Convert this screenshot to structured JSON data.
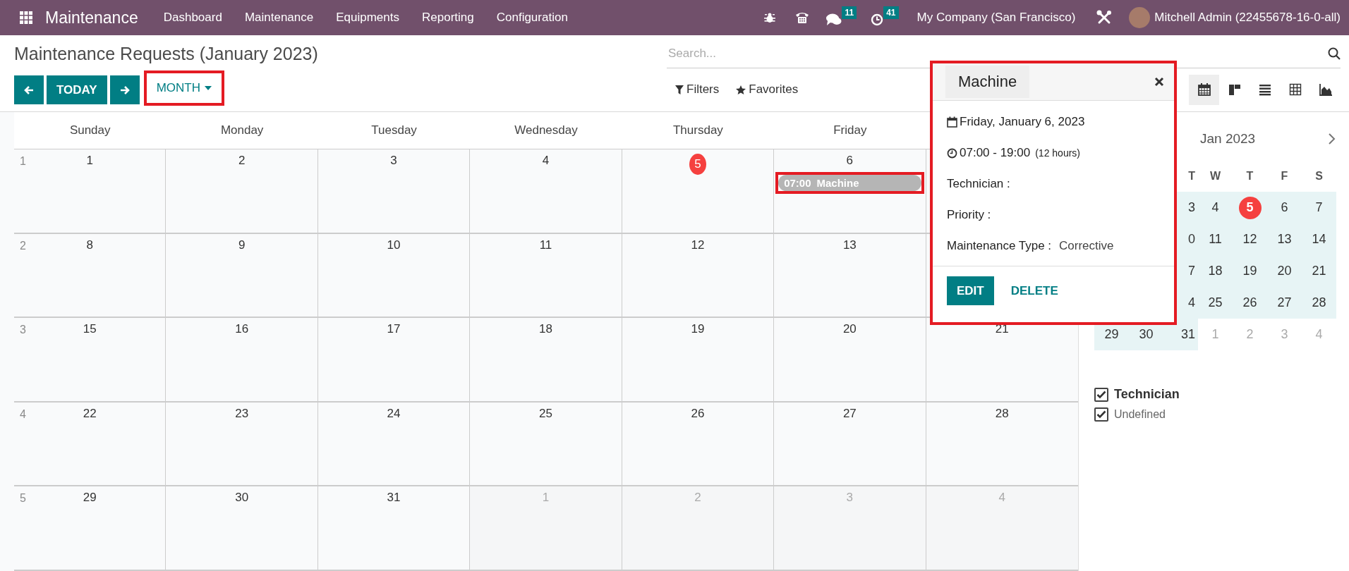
{
  "topbar": {
    "app": "Maintenance",
    "menu": [
      "Dashboard",
      "Maintenance",
      "Equipments",
      "Reporting",
      "Configuration"
    ],
    "messages_count": "11",
    "activities_count": "41",
    "company": "My Company (San Francisco)",
    "user": "Mitchell Admin (22455678-16-0-all)"
  },
  "control_panel": {
    "title": "Maintenance Requests (January 2023)",
    "today_button": "TODAY",
    "scale": {
      "label": "MONTH",
      "highlighted": true
    },
    "search": {
      "placeholder": "Search..."
    },
    "filters": "Filters",
    "favorites": "Favorites",
    "views": [
      {
        "kind": "calendar",
        "selected": true
      },
      {
        "kind": "kanban",
        "selected": false
      },
      {
        "kind": "list",
        "selected": false
      },
      {
        "kind": "pivot",
        "selected": false
      },
      {
        "kind": "graph",
        "selected": false
      }
    ]
  },
  "calendar": {
    "weekdays": [
      "Sunday",
      "Monday",
      "Tuesday",
      "Wednesday",
      "Thursday",
      "Friday"
    ],
    "weeks": [
      {
        "number": "1",
        "days": [
          {
            "label": "1",
            "muted": false,
            "today": false
          },
          {
            "label": "2",
            "muted": false,
            "today": false
          },
          {
            "label": "3",
            "muted": false,
            "today": false
          },
          {
            "label": "4",
            "muted": false,
            "today": false
          },
          {
            "label": "5",
            "muted": false,
            "today": true
          },
          {
            "label": "6",
            "muted": false,
            "today": false,
            "events": [
              {
                "time": "07:00",
                "title": "Machine",
                "highlighted": true
              }
            ]
          }
        ]
      },
      {
        "number": "2",
        "days": [
          {
            "label": "8",
            "muted": false,
            "today": false
          },
          {
            "label": "9",
            "muted": false,
            "today": false
          },
          {
            "label": "10",
            "muted": false,
            "today": false
          },
          {
            "label": "11",
            "muted": false,
            "today": false
          },
          {
            "label": "12",
            "muted": false,
            "today": false
          },
          {
            "label": "13",
            "muted": false,
            "today": false
          }
        ]
      },
      {
        "number": "3",
        "days": [
          {
            "label": "15",
            "muted": false,
            "today": false
          },
          {
            "label": "16",
            "muted": false,
            "today": false
          },
          {
            "label": "17",
            "muted": false,
            "today": false
          },
          {
            "label": "18",
            "muted": false,
            "today": false
          },
          {
            "label": "19",
            "muted": false,
            "today": false
          },
          {
            "label": "20",
            "muted": false,
            "today": false
          },
          {
            "label": "21",
            "muted": false,
            "today": false
          }
        ]
      },
      {
        "number": "4",
        "days": [
          {
            "label": "22",
            "muted": false,
            "today": false
          },
          {
            "label": "23",
            "muted": false,
            "today": false
          },
          {
            "label": "24",
            "muted": false,
            "today": false
          },
          {
            "label": "25",
            "muted": false,
            "today": false
          },
          {
            "label": "26",
            "muted": false,
            "today": false
          },
          {
            "label": "27",
            "muted": false,
            "today": false
          },
          {
            "label": "28",
            "muted": false,
            "today": false
          }
        ]
      },
      {
        "number": "5",
        "days": [
          {
            "label": "29",
            "muted": false,
            "today": false
          },
          {
            "label": "30",
            "muted": false,
            "today": false
          },
          {
            "label": "31",
            "muted": false,
            "today": false
          },
          {
            "label": "1",
            "muted": true,
            "today": false
          },
          {
            "label": "2",
            "muted": true,
            "today": false
          },
          {
            "label": "3",
            "muted": true,
            "today": false
          },
          {
            "label": "4",
            "muted": true,
            "today": false
          }
        ]
      }
    ]
  },
  "popover": {
    "title": "Machine",
    "date": "Friday, January 6, 2023",
    "time": "07:00 - 19:00",
    "duration": "(12 hours)",
    "highlighted": true,
    "fields": [
      {
        "label": "Technician :"
      },
      {
        "label": "Priority :"
      },
      {
        "label": "Maintenance Type :",
        "value": "Corrective"
      }
    ],
    "buttons": [
      {
        "label": "EDIT",
        "kind": "primary"
      },
      {
        "label": "DELETE",
        "kind": "link"
      }
    ]
  },
  "mini_calendar": {
    "month": "Jan 2023",
    "weekdays": [
      {
        "label": "T"
      },
      {
        "label": "W"
      },
      {
        "label": "T"
      },
      {
        "label": "F"
      },
      {
        "label": "S"
      }
    ],
    "weeks": [
      [
        {
          "label": "3",
          "muted": false,
          "today": false
        },
        {
          "label": "4",
          "muted": false,
          "today": false
        },
        {
          "label": "5",
          "muted": false,
          "today": true
        },
        {
          "label": "6",
          "muted": false,
          "today": false
        },
        {
          "label": "7",
          "muted": false,
          "today": false
        }
      ],
      [
        {
          "label": "0",
          "muted": false,
          "today": false
        },
        {
          "label": "11",
          "muted": false,
          "today": false
        },
        {
          "label": "12",
          "muted": false,
          "today": false
        },
        {
          "label": "13",
          "muted": false,
          "today": false
        },
        {
          "label": "14",
          "muted": false,
          "today": false
        }
      ],
      [
        {
          "label": "7",
          "muted": false,
          "today": false
        },
        {
          "label": "18",
          "muted": false,
          "today": false
        },
        {
          "label": "19",
          "muted": false,
          "today": false
        },
        {
          "label": "20",
          "muted": false,
          "today": false
        },
        {
          "label": "21",
          "muted": false,
          "today": false
        }
      ],
      [
        {
          "label": "4",
          "muted": false,
          "today": false
        },
        {
          "label": "25",
          "muted": false,
          "today": false
        },
        {
          "label": "26",
          "muted": false,
          "today": false
        },
        {
          "label": "27",
          "muted": false,
          "today": false
        },
        {
          "label": "28",
          "muted": false,
          "today": false
        }
      ],
      [
        {
          "label": "29",
          "muted": false,
          "today": false
        },
        {
          "label": "30",
          "muted": false,
          "today": false
        },
        {
          "label": "31",
          "muted": false,
          "today": false
        },
        {
          "label": "1",
          "muted": true,
          "today": false
        },
        {
          "label": "2",
          "muted": true,
          "today": false
        },
        {
          "label": "3",
          "muted": true,
          "today": false
        },
        {
          "label": "4",
          "muted": true,
          "today": false
        }
      ]
    ]
  },
  "attendee_filter": {
    "title": {
      "label": "Technician",
      "checked": true
    },
    "items": [
      {
        "label": "Undefined",
        "checked": true
      }
    ]
  }
}
